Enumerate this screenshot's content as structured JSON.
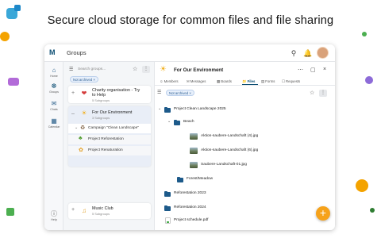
{
  "headline": "Secure cloud storage for common files and file sharing",
  "app": {
    "title": "Groups",
    "logo_text": "M",
    "rail": [
      {
        "label": "Home",
        "icon": "home-icon"
      },
      {
        "label": "Groups",
        "icon": "groups-icon"
      },
      {
        "label": "Chats",
        "icon": "chat-icon"
      },
      {
        "label": "Calendar",
        "icon": "calendar-icon"
      }
    ],
    "help_label": "Help"
  },
  "groups_panel": {
    "search_placeholder": "Search groups...",
    "filter_chip": "Not archived",
    "groups": [
      {
        "name_line1": "Charity organisation - Try",
        "name_line2": "to Help",
        "sub": "5 Subgroups"
      },
      {
        "name_line1": "For Our Environment",
        "name_line2": "",
        "sub": "3 Subgroups"
      },
      {
        "name_line1": "Music Club",
        "name_line2": "",
        "sub": "5 Subgroups"
      }
    ],
    "subgroups": [
      {
        "name": "Campaign \"Clean Landscape\""
      },
      {
        "name": "Project Reforestation"
      },
      {
        "name": "Project Renaturation"
      }
    ]
  },
  "detail": {
    "title": "For Our Environment",
    "tabs": [
      "Members",
      "Messages",
      "Boards",
      "Files",
      "Forms",
      "Requests"
    ],
    "active_tab": "Files",
    "filter_chip": "Not archived",
    "tree": [
      {
        "name": "Project Clean Landscape 2025"
      },
      {
        "name": "Beach"
      },
      {
        "name": "Aktion-saubere-Landschaft (4).jpg"
      },
      {
        "name": "Aktion-saubere-Landschaft (6).jpg"
      },
      {
        "name": "Saubere-Landschaft-01.jpg"
      },
      {
        "name": "Forest/Meadow"
      },
      {
        "name": "Reforestation 2023"
      },
      {
        "name": "Reforestation 2024"
      },
      {
        "name": "Project schedule.pdf"
      }
    ]
  },
  "fab_label": "+",
  "colors": {
    "accent": "#0b4d73",
    "fab": "#f6a21a",
    "folder": "#1d5a8a"
  }
}
